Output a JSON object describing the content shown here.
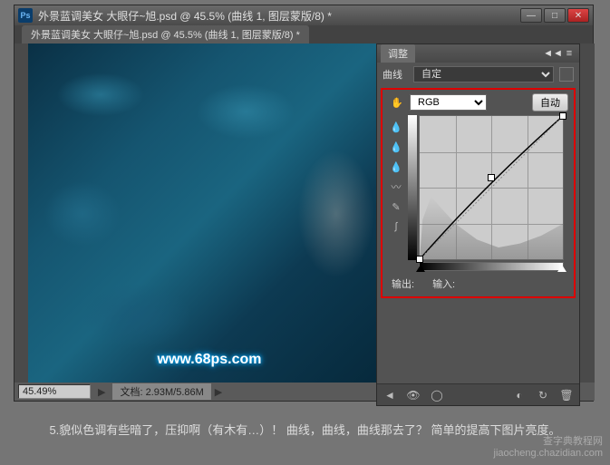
{
  "window": {
    "ps_logo": "Ps",
    "title": "外景蓝调美女 大眼仔~旭.psd @ 45.5% (曲线 1, 图层蒙版/8) *",
    "minimize": "—",
    "maximize": "□",
    "close": "✕"
  },
  "doc_tab": "外景蓝调美女 大眼仔~旭.psd @ 45.5% (曲线 1, 图层蒙版/8) *",
  "image_watermark": "www.68ps.com",
  "statusbar": {
    "zoom": "45.49%",
    "doc_label": "文档:",
    "doc_size": "2.93M/5.86M",
    "arrow": "▶"
  },
  "panel": {
    "tab": "调整",
    "collapse": "◄◄",
    "menu": "≡",
    "curves_label": "曲线",
    "preset": "自定",
    "channel": "RGB",
    "auto_btn": "自动",
    "output_label": "输出:",
    "input_label": "输入:"
  },
  "tools": {
    "hand": "✋",
    "eyedropper1": "💧",
    "eyedropper2": "💧",
    "eyedropper3": "💧",
    "curve": "〰",
    "pencil": "✎",
    "smooth": "∫"
  },
  "footer_icons": {
    "back": "◄",
    "eye": "👁",
    "ring": "◯",
    "clip": "◐",
    "reset": "↻",
    "trash": "🗑"
  },
  "chart_data": {
    "type": "line",
    "title": "Curves",
    "xlabel": "输入",
    "ylabel": "输出",
    "xlim": [
      0,
      255
    ],
    "ylim": [
      0,
      255
    ],
    "points": [
      {
        "x": 0,
        "y": 0
      },
      {
        "x": 128,
        "y": 145
      },
      {
        "x": 255,
        "y": 255
      }
    ]
  },
  "caption": "5.貌似色调有些暗了，压抑啊（有木有…）！ 曲线，曲线，曲线那去了？ 简单的提高下图片亮度。",
  "site": {
    "name": "查字典教程网",
    "url": "jiaocheng.chazidian.com"
  }
}
